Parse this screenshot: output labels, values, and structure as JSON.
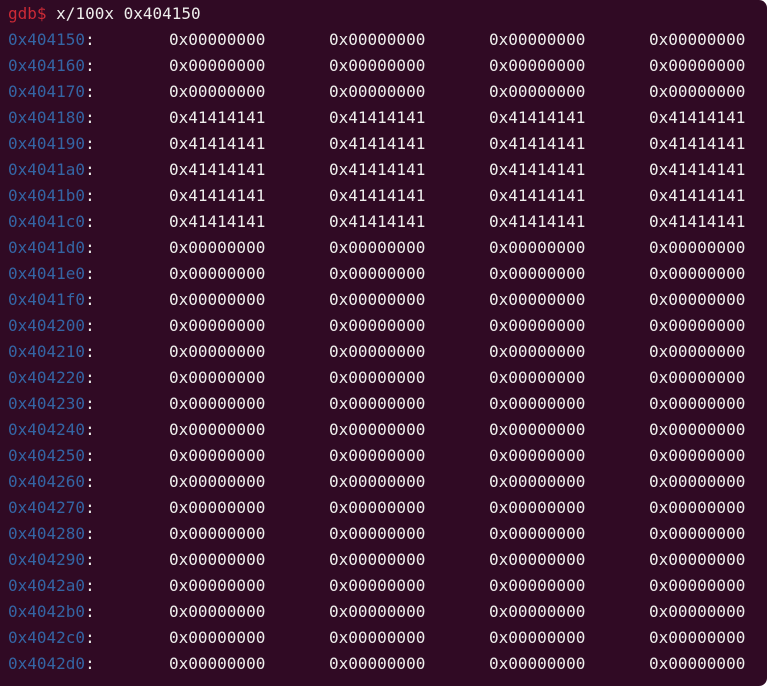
{
  "prompt": {
    "label": "gdb$",
    "command": "x/100x 0x404150"
  },
  "memory_rows": [
    {
      "address": "0x404150",
      "values": [
        "0x00000000",
        "0x00000000",
        "0x00000000",
        "0x00000000"
      ]
    },
    {
      "address": "0x404160",
      "values": [
        "0x00000000",
        "0x00000000",
        "0x00000000",
        "0x00000000"
      ]
    },
    {
      "address": "0x404170",
      "values": [
        "0x00000000",
        "0x00000000",
        "0x00000000",
        "0x00000000"
      ]
    },
    {
      "address": "0x404180",
      "values": [
        "0x41414141",
        "0x41414141",
        "0x41414141",
        "0x41414141"
      ]
    },
    {
      "address": "0x404190",
      "values": [
        "0x41414141",
        "0x41414141",
        "0x41414141",
        "0x41414141"
      ]
    },
    {
      "address": "0x4041a0",
      "values": [
        "0x41414141",
        "0x41414141",
        "0x41414141",
        "0x41414141"
      ]
    },
    {
      "address": "0x4041b0",
      "values": [
        "0x41414141",
        "0x41414141",
        "0x41414141",
        "0x41414141"
      ]
    },
    {
      "address": "0x4041c0",
      "values": [
        "0x41414141",
        "0x41414141",
        "0x41414141",
        "0x41414141"
      ]
    },
    {
      "address": "0x4041d0",
      "values": [
        "0x00000000",
        "0x00000000",
        "0x00000000",
        "0x00000000"
      ]
    },
    {
      "address": "0x4041e0",
      "values": [
        "0x00000000",
        "0x00000000",
        "0x00000000",
        "0x00000000"
      ]
    },
    {
      "address": "0x4041f0",
      "values": [
        "0x00000000",
        "0x00000000",
        "0x00000000",
        "0x00000000"
      ]
    },
    {
      "address": "0x404200",
      "values": [
        "0x00000000",
        "0x00000000",
        "0x00000000",
        "0x00000000"
      ]
    },
    {
      "address": "0x404210",
      "values": [
        "0x00000000",
        "0x00000000",
        "0x00000000",
        "0x00000000"
      ]
    },
    {
      "address": "0x404220",
      "values": [
        "0x00000000",
        "0x00000000",
        "0x00000000",
        "0x00000000"
      ]
    },
    {
      "address": "0x404230",
      "values": [
        "0x00000000",
        "0x00000000",
        "0x00000000",
        "0x00000000"
      ]
    },
    {
      "address": "0x404240",
      "values": [
        "0x00000000",
        "0x00000000",
        "0x00000000",
        "0x00000000"
      ]
    },
    {
      "address": "0x404250",
      "values": [
        "0x00000000",
        "0x00000000",
        "0x00000000",
        "0x00000000"
      ]
    },
    {
      "address": "0x404260",
      "values": [
        "0x00000000",
        "0x00000000",
        "0x00000000",
        "0x00000000"
      ]
    },
    {
      "address": "0x404270",
      "values": [
        "0x00000000",
        "0x00000000",
        "0x00000000",
        "0x00000000"
      ]
    },
    {
      "address": "0x404280",
      "values": [
        "0x00000000",
        "0x00000000",
        "0x00000000",
        "0x00000000"
      ]
    },
    {
      "address": "0x404290",
      "values": [
        "0x00000000",
        "0x00000000",
        "0x00000000",
        "0x00000000"
      ]
    },
    {
      "address": "0x4042a0",
      "values": [
        "0x00000000",
        "0x00000000",
        "0x00000000",
        "0x00000000"
      ]
    },
    {
      "address": "0x4042b0",
      "values": [
        "0x00000000",
        "0x00000000",
        "0x00000000",
        "0x00000000"
      ]
    },
    {
      "address": "0x4042c0",
      "values": [
        "0x00000000",
        "0x00000000",
        "0x00000000",
        "0x00000000"
      ]
    },
    {
      "address": "0x4042d0",
      "values": [
        "0x00000000",
        "0x00000000",
        "0x00000000",
        "0x00000000"
      ]
    }
  ],
  "separator": ":",
  "colors": {
    "background": "#300a24",
    "prompt": "#cc2a36",
    "address": "#3465a4",
    "text": "#eeeeec"
  }
}
